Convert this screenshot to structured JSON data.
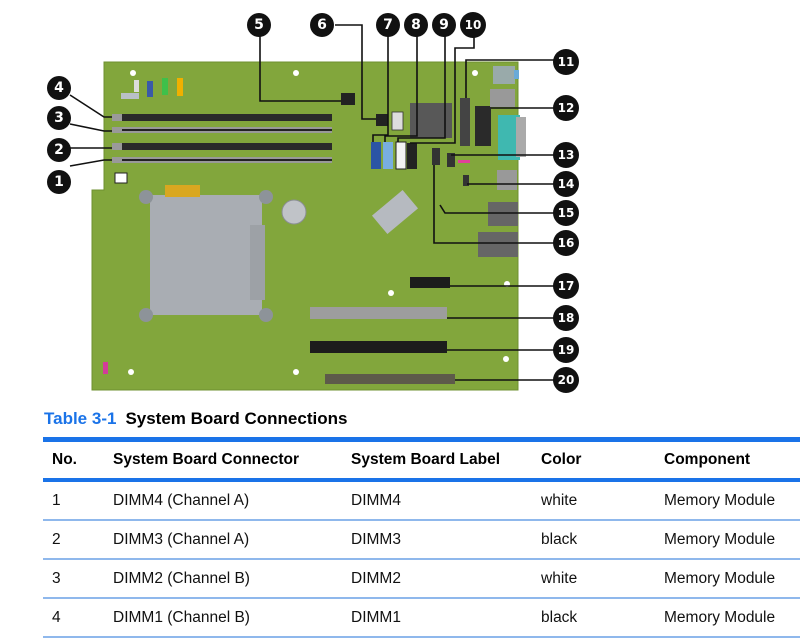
{
  "figure": {
    "title": "System board with numbered connector callouts",
    "callouts": [
      "1",
      "2",
      "3",
      "4",
      "5",
      "6",
      "7",
      "8",
      "9",
      "10",
      "11",
      "12",
      "13",
      "14",
      "15",
      "16",
      "17",
      "18",
      "19",
      "20"
    ],
    "colors": {
      "board": "#82a63c",
      "callout": "#111111",
      "accent": "#1a73e8"
    }
  },
  "table": {
    "number": "Table 3-1",
    "title": "System Board Connections",
    "columns": [
      "No.",
      "System Board Connector",
      "System Board Label",
      "Color",
      "Component"
    ],
    "rows": [
      [
        "1",
        "DIMM4 (Channel A)",
        "DIMM4",
        "white",
        "Memory Module"
      ],
      [
        "2",
        "DIMM3 (Channel A)",
        "DIMM3",
        "black",
        "Memory Module"
      ],
      [
        "3",
        "DIMM2 (Channel B)",
        "DIMM2",
        "white",
        "Memory Module"
      ],
      [
        "4",
        "DIMM1 (Channel B)",
        "DIMM1",
        "black",
        "Memory Module"
      ]
    ]
  }
}
